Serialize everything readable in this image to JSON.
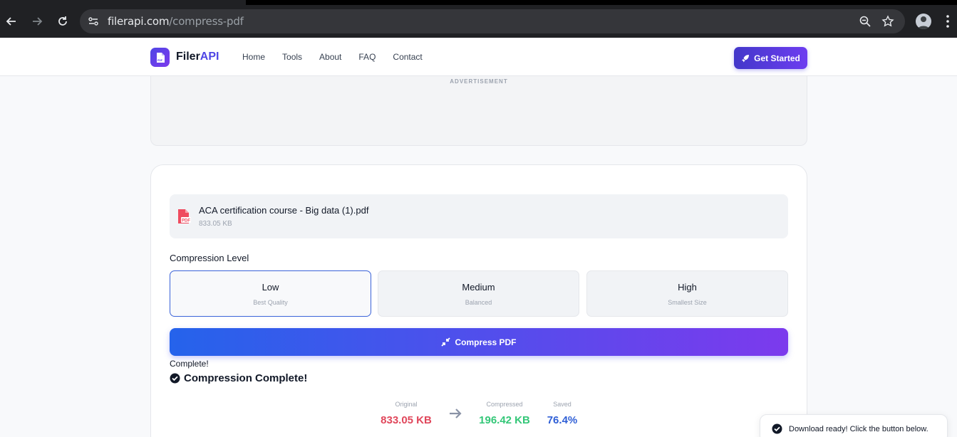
{
  "browser": {
    "url_host": "filerapi.com",
    "url_path": "/compress-pdf"
  },
  "header": {
    "logo_main": "Filer",
    "logo_accent": "API",
    "nav": [
      "Home",
      "Tools",
      "About",
      "FAQ",
      "Contact"
    ],
    "cta_label": "Get Started"
  },
  "ad": {
    "label": "ADVERTISEMENT"
  },
  "file": {
    "name": "ACA certification course - Big data (1).pdf",
    "size": "833.05 KB"
  },
  "compression": {
    "label": "Compression Level",
    "levels": [
      {
        "name": "Low",
        "desc": "Best Quality",
        "selected": true
      },
      {
        "name": "Medium",
        "desc": "Balanced",
        "selected": false
      },
      {
        "name": "High",
        "desc": "Smallest Size",
        "selected": false
      }
    ],
    "button_label": "Compress PDF"
  },
  "result": {
    "status": "Complete!",
    "heading": "Compression Complete!",
    "original_label": "Original",
    "original_value": "833.05 KB",
    "compressed_label": "Compressed",
    "compressed_value": "196.42 KB",
    "saved_label": "Saved",
    "saved_value": "76.4%"
  },
  "toast": {
    "text": "Download ready! Click the button below."
  },
  "colors": {
    "brand": "#4f46e5",
    "original": "#e0475b",
    "compressed": "#34c778",
    "saved": "#2f5fd6"
  }
}
